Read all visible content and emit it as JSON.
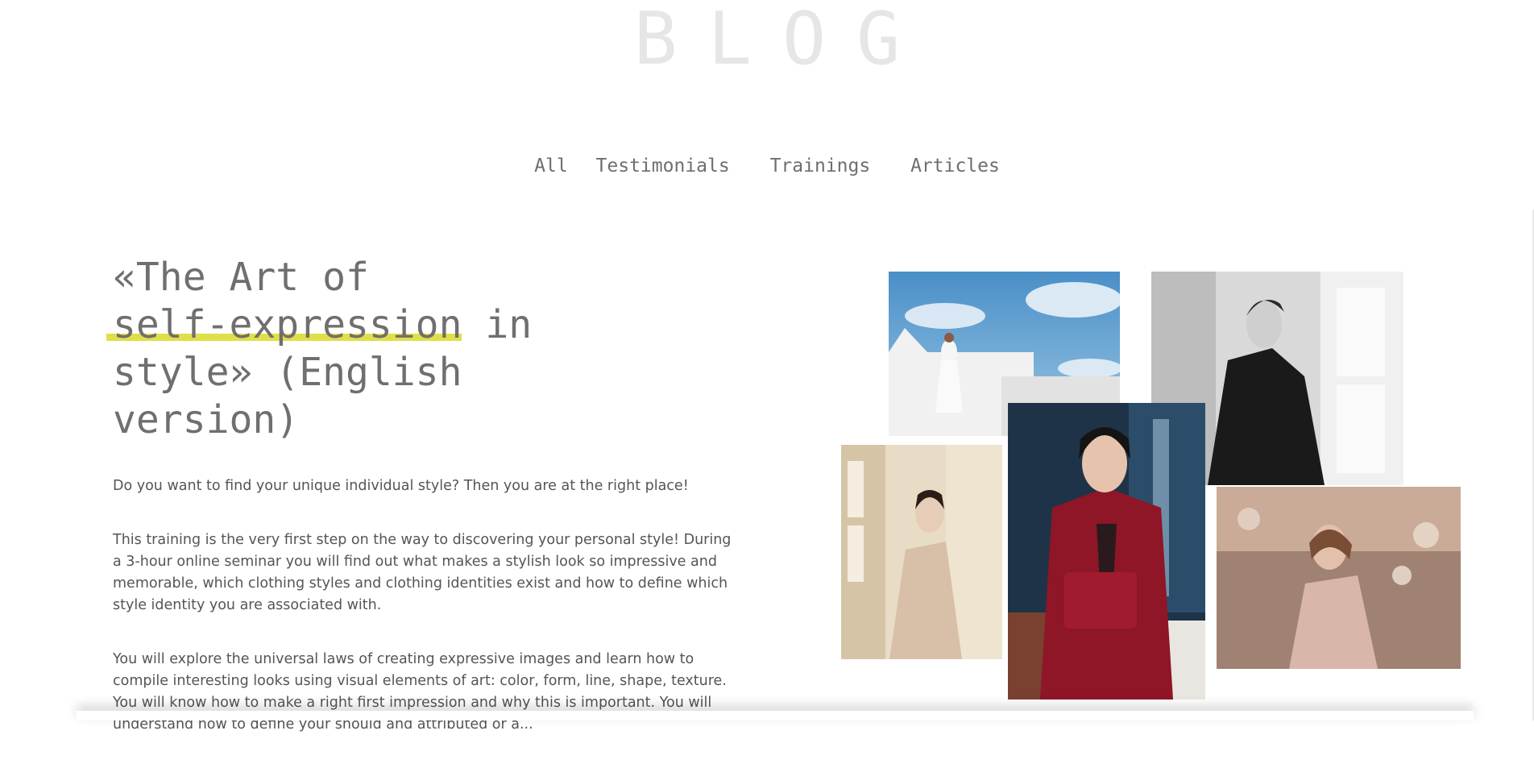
{
  "page": {
    "heading": "BLOG"
  },
  "filters": [
    {
      "label": "All"
    },
    {
      "label": "Testimonials"
    },
    {
      "label": "Trainings"
    },
    {
      "label": "Articles"
    }
  ],
  "post": {
    "title_prefix": "«The Art of",
    "title_highlight": "self-expression",
    "title_rest": " in style» (English version)",
    "paragraphs": [
      "Do you want to find your unique individual style? Then you are at the right place!",
      "This training is the very first step on the way to discovering your personal style! During a 3-hour online seminar you will find out what makes a stylish look so impressive and memorable, which clothing styles and clothing identities exist and how to define which style identity you are associated with.",
      "You will explore the universal laws of creating expressive images and learn how to compile interesting looks using visual elements of art: color, form, line, shape, texture. You will know how to make a right first impression and why this is important. You will understand how to define your should and attributed or a..."
    ]
  },
  "colors": {
    "highlight": "#e1df48",
    "text": "#6f6f6f",
    "heading": "#e6e6e6"
  }
}
